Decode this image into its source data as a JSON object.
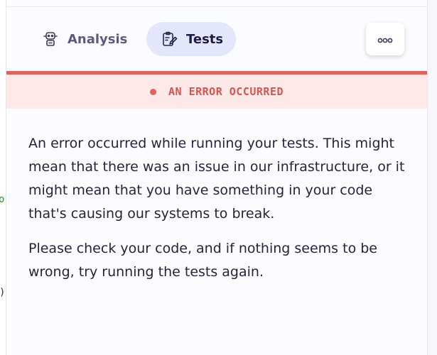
{
  "tabs": [
    {
      "label": "Analysis",
      "icon": "robot-icon",
      "active": false
    },
    {
      "label": "Tests",
      "icon": "clipboard-pencil-icon",
      "active": true
    }
  ],
  "more_button": {
    "icon": "more-dots-icon"
  },
  "error": {
    "label": "AN ERROR OCCURRED",
    "color": "#e0625e",
    "background": "#fce9e8"
  },
  "message": {
    "paragraph1": "An error occurred while running your tests. This might mean that there was an issue in our infrastructure, or it might mean that you have something in your code that's causing our systems to break.",
    "paragraph2": "Please check your code, and if nothing seems to be wrong, try running the tests again."
  },
  "left_edge_fragments": {
    "a": "o",
    "b": ")"
  },
  "colors": {
    "accent_tab_bg": "#e2e7fb",
    "text": "#26233f"
  }
}
